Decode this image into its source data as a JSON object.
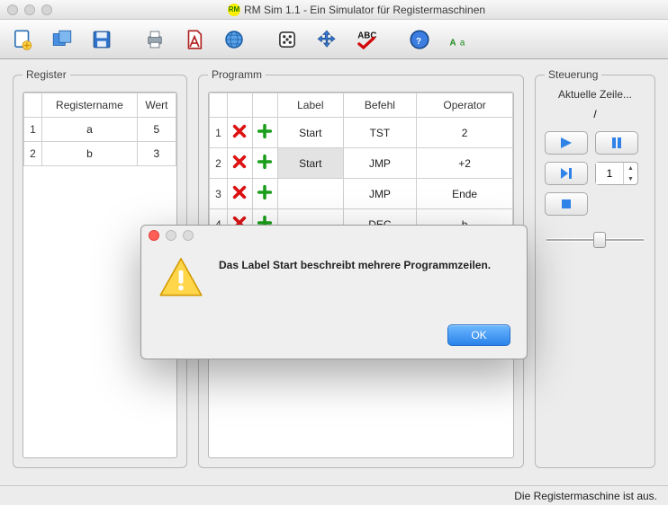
{
  "window": {
    "title": "RM Sim 1.1 - Ein Simulator für Registermaschinen"
  },
  "toolbar": {
    "icons": [
      "new",
      "windows",
      "save",
      "print",
      "pdf",
      "globe",
      "dice",
      "move",
      "spellcheck",
      "help",
      "font"
    ]
  },
  "register": {
    "legend": "Register",
    "headers": {
      "name": "Registername",
      "value": "Wert"
    },
    "rows": [
      {
        "idx": "1",
        "name": "a",
        "value": "5"
      },
      {
        "idx": "2",
        "name": "b",
        "value": "3"
      }
    ]
  },
  "program": {
    "legend": "Programm",
    "headers": {
      "label": "Label",
      "cmd": "Befehl",
      "op": "Operator"
    },
    "rows": [
      {
        "idx": "1",
        "label": "Start",
        "cmd": "TST",
        "op": "2",
        "sel": false
      },
      {
        "idx": "2",
        "label": "Start",
        "cmd": "JMP",
        "op": "+2",
        "sel": true
      },
      {
        "idx": "3",
        "label": "",
        "cmd": "JMP",
        "op": "Ende",
        "sel": false
      },
      {
        "idx": "4",
        "label": "",
        "cmd": "DEC",
        "op": "b",
        "sel": false
      }
    ]
  },
  "control": {
    "legend": "Steuerung",
    "lineLabel": "Aktuelle Zeile...",
    "lineValue": "/",
    "stepValue": "1"
  },
  "dialog": {
    "message": "Das Label Start beschreibt mehrere Programmzeilen.",
    "ok": "OK"
  },
  "status": {
    "text": "Die Registermaschine ist aus."
  }
}
